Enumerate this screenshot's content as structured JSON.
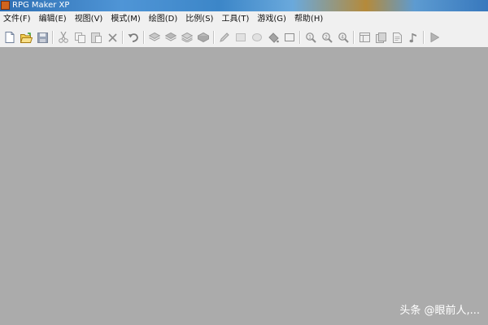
{
  "window": {
    "title": "RPG Maker XP",
    "icon": "rpg-maker-icon"
  },
  "menu": {
    "items": [
      {
        "label": "文件(F)"
      },
      {
        "label": "编辑(E)"
      },
      {
        "label": "视图(V)"
      },
      {
        "label": "模式(M)"
      },
      {
        "label": "绘图(D)"
      },
      {
        "label": "比例(S)"
      },
      {
        "label": "工具(T)"
      },
      {
        "label": "游戏(G)"
      },
      {
        "label": "帮助(H)"
      }
    ]
  },
  "toolbar": {
    "groups": [
      [
        "new-project-icon",
        "open-project-icon",
        "save-project-icon"
      ],
      [
        "cut-icon",
        "copy-icon",
        "paste-icon",
        "delete-icon"
      ],
      [
        "undo-icon"
      ],
      [
        "layer1-icon",
        "layer2-icon",
        "layer3-icon",
        "events-layer-icon"
      ],
      [
        "pencil-icon",
        "rectangle-icon",
        "ellipse-icon",
        "fill-icon",
        "select-icon"
      ],
      [
        "zoom-1x-icon",
        "zoom-half-icon",
        "zoom-quarter-icon"
      ],
      [
        "database-icon",
        "material-base-icon",
        "script-editor-icon",
        "sound-test-icon"
      ],
      [
        "playtest-icon"
      ]
    ]
  },
  "watermark": {
    "text": "头条 @眼前人,..."
  },
  "colors": {
    "canvas": "#ababab",
    "menubar": "#f0f0f0",
    "disabled_icon": "#8a8a8a"
  }
}
